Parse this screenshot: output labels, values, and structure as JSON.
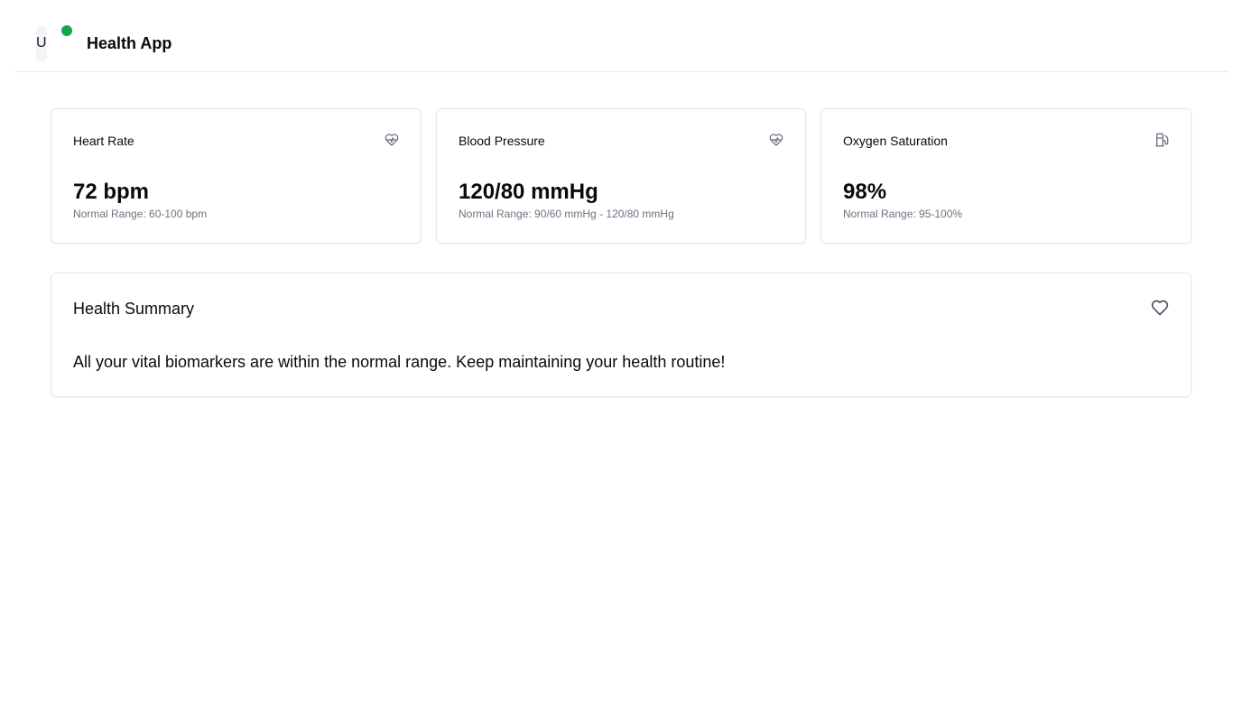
{
  "header": {
    "avatar_initial": "U",
    "app_title": "Health App",
    "status_color": "#16a34a"
  },
  "metrics": [
    {
      "title": "Heart Rate",
      "icon": "heart-pulse-icon",
      "value": "72 bpm",
      "range": "Normal Range: 60-100 bpm"
    },
    {
      "title": "Blood Pressure",
      "icon": "heart-pulse-icon",
      "value": "120/80 mmHg",
      "range": "Normal Range: 90/60 mmHg - 120/80 mmHg"
    },
    {
      "title": "Oxygen Saturation",
      "icon": "fuel-icon",
      "value": "98%",
      "range": "Normal Range: 95-100%"
    }
  ],
  "summary": {
    "title": "Health Summary",
    "icon": "heart-icon",
    "text": "All your vital biomarkers are within the normal range. Keep maintaining your health routine!"
  }
}
